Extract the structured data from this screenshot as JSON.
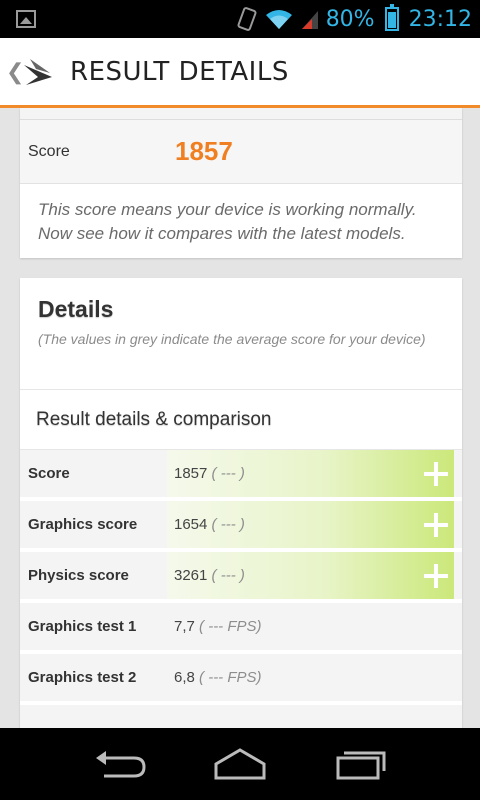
{
  "status_bar": {
    "battery_percent": "80%",
    "time": "23:12",
    "icons": [
      "image-icon",
      "vibrate-icon",
      "wifi-icon",
      "signal-icon",
      "battery-icon"
    ]
  },
  "action_bar": {
    "title": "RESULT DETAILS",
    "back_icon": "chevron-left-icon",
    "logo_icon": "3dmark-logo-icon"
  },
  "score_card": {
    "label": "Score",
    "value": "1857",
    "description": "This score means your device is working normally. Now see how it compares with the latest models."
  },
  "details_card": {
    "title": "Details",
    "subtitle": "(The values in grey indicate the average score for your device)",
    "section_title": "Result details & comparison",
    "rows": [
      {
        "label": "Score",
        "value": "1857",
        "avg": "( --- )",
        "expandable": true
      },
      {
        "label": "Graphics score",
        "value": "1654",
        "avg": "( --- )",
        "expandable": true
      },
      {
        "label": "Physics score",
        "value": "3261",
        "avg": "( --- )",
        "expandable": true
      },
      {
        "label": "Graphics test 1",
        "value": "7,7",
        "avg": "( --- FPS)",
        "expandable": false
      },
      {
        "label": "Graphics test 2",
        "value": "6,8",
        "avg": "( --- FPS)",
        "expandable": false
      }
    ]
  },
  "nav_bar": {
    "icons": [
      "back-icon",
      "home-icon",
      "recent-apps-icon"
    ]
  },
  "colors": {
    "accent_orange": "#f07f22",
    "status_blue": "#33b5e5",
    "highlight_green": "#cbe87a"
  }
}
